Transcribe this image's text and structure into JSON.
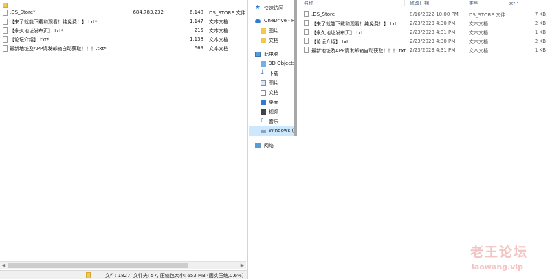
{
  "archive": {
    "rows": [
      {
        "name": "..",
        "size": "",
        "packed": "",
        "type": "",
        "icon": "folder-up-icon"
      },
      {
        "name": ".DS_Store*",
        "size": "684,783,232",
        "packed": "6,148",
        "type": "DS_STORE 文件",
        "icon": "file-icon"
      },
      {
        "name": "【来了就能下载和观看！纯免费！】.txt*",
        "size": "",
        "packed": "1,147",
        "type": "文本文档",
        "icon": "file-icon"
      },
      {
        "name": "【永久地址发布页】.txt*",
        "size": "",
        "packed": "215",
        "type": "文本文档",
        "icon": "file-icon"
      },
      {
        "name": "【论坛介绍】.txt*",
        "size": "",
        "packed": "1,138",
        "type": "文本文档",
        "icon": "file-icon"
      },
      {
        "name": "最新地址及APP请发邮箱自动获取！！！.txt*",
        "size": "",
        "packed": "669",
        "type": "文本文档",
        "icon": "file-icon"
      }
    ],
    "status_text": "文件: 1827, 文件夹: 57, 压缩包大小: 653 MB (固实压缩,0.6%)"
  },
  "nav": {
    "items": [
      {
        "label": "快速访问",
        "icon": "star-icon",
        "indent": 0
      },
      {
        "label": "OneDrive - Personal",
        "icon": "cloud-icon",
        "indent": 0
      },
      {
        "label": "图片",
        "icon": "folder-icon",
        "indent": 1
      },
      {
        "label": "文档",
        "icon": "folder-icon",
        "indent": 1
      },
      {
        "label": "此电脑",
        "icon": "computer-icon",
        "indent": 0
      },
      {
        "label": "3D Objects",
        "icon": "cube-icon",
        "indent": 1
      },
      {
        "label": "下载",
        "icon": "download-icon",
        "indent": 1
      },
      {
        "label": "图片",
        "icon": "pictures-icon",
        "indent": 1
      },
      {
        "label": "文档",
        "icon": "documents-icon",
        "indent": 1
      },
      {
        "label": "桌面",
        "icon": "desktop-icon",
        "indent": 1
      },
      {
        "label": "视频",
        "icon": "video-icon",
        "indent": 1
      },
      {
        "label": "音乐",
        "icon": "music-icon",
        "indent": 1
      },
      {
        "label": "Windows (C:)",
        "icon": "drive-icon",
        "indent": 1
      },
      {
        "label": "网络",
        "icon": "network-icon",
        "indent": 0
      }
    ]
  },
  "explorer": {
    "headers": {
      "name": "名称",
      "date": "修改日期",
      "type": "类型",
      "size": "大小"
    },
    "files": [
      {
        "name": ".DS_Store",
        "date": "8/16/2022 10:00 PM",
        "type": "DS_STORE 文件",
        "size": "7 KB"
      },
      {
        "name": "【来了就能下载和观看！纯免费！】.txt",
        "date": "2/23/2023 4:30 PM",
        "type": "文本文档",
        "size": "2 KB"
      },
      {
        "name": "【永久地址发布页】.txt",
        "date": "2/23/2023 4:31 PM",
        "type": "文本文档",
        "size": "1 KB"
      },
      {
        "name": "【论坛介绍】.txt",
        "date": "2/23/2023 4:30 PM",
        "type": "文本文档",
        "size": "2 KB"
      },
      {
        "name": "最新地址及APP请发邮箱自动获取！！！.txt",
        "date": "2/23/2023 4:31 PM",
        "type": "文本文档",
        "size": "1 KB"
      }
    ]
  },
  "watermark": {
    "title": "老王论坛",
    "url": "laowang.vip"
  },
  "colors": {
    "selection": "#cce8ff",
    "folder": "#f2c94c",
    "watermark": "#f2c4c4"
  }
}
